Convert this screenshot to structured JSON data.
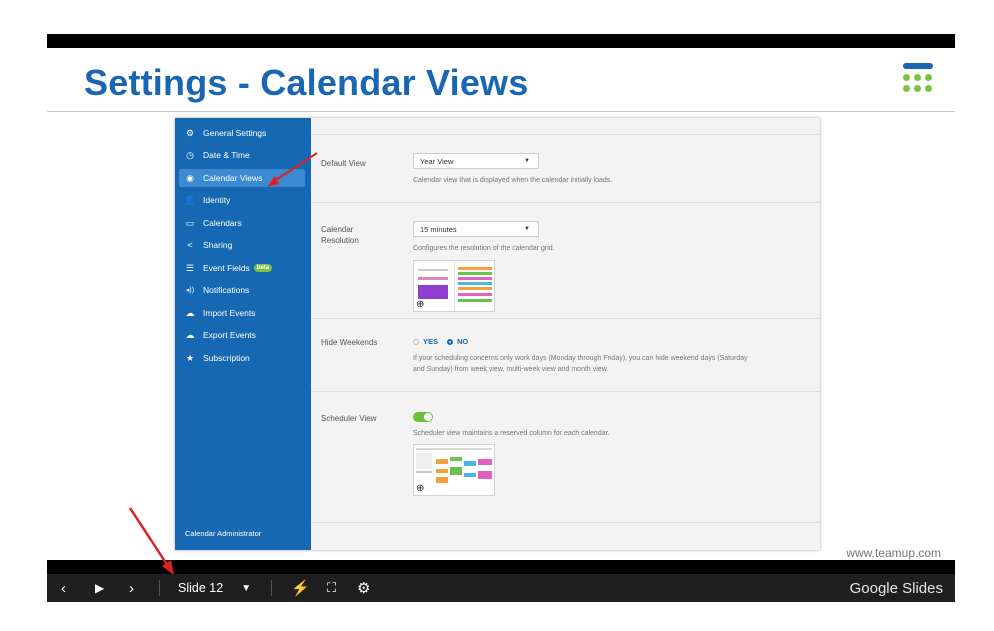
{
  "slide": {
    "title": "Settings - Calendar Views",
    "watermark": "www.teamup.com"
  },
  "sidebar": {
    "items": [
      {
        "label": "General Settings",
        "icon": "gear-icon",
        "glyph": "⚙"
      },
      {
        "label": "Date & Time",
        "icon": "clock-icon",
        "glyph": "◷"
      },
      {
        "label": "Calendar Views",
        "icon": "eye-icon",
        "glyph": "◉",
        "active": true
      },
      {
        "label": "Identity",
        "icon": "user-icon",
        "glyph": "👤"
      },
      {
        "label": "Calendars",
        "icon": "calendar-icon",
        "glyph": "▭"
      },
      {
        "label": "Sharing",
        "icon": "share-icon",
        "glyph": "<"
      },
      {
        "label": "Event Fields",
        "icon": "list-icon",
        "glyph": "☰",
        "badge": "beta"
      },
      {
        "label": "Notifications",
        "icon": "speaker-icon",
        "glyph": "◂))"
      },
      {
        "label": "Import Events",
        "icon": "cloud-upload-icon",
        "glyph": "☁"
      },
      {
        "label": "Export Events",
        "icon": "cloud-download-icon",
        "glyph": "☁"
      },
      {
        "label": "Subscription",
        "icon": "star-icon",
        "glyph": "★"
      }
    ],
    "footer": "Calendar Administrator"
  },
  "settings": {
    "default_view": {
      "label": "Default View",
      "value": "Year View",
      "description": "Calendar view that is displayed when the calendar initially loads."
    },
    "calendar_resolution": {
      "label_line1": "Calendar",
      "label_line2": "Resolution",
      "value": "15 minutes",
      "description": "Configures the resolution of the calendar grid."
    },
    "hide_weekends": {
      "label": "Hide Weekends",
      "yes": "YES",
      "no": "NO",
      "selected": "NO",
      "description_line1": "If your scheduling concerns only work days (Monday through Friday), you can hide weekend days (Saturday",
      "description_line2": "and Sunday) from week view, multi-week view and month view."
    },
    "scheduler_view": {
      "label": "Scheduler View",
      "enabled": true,
      "description": "Scheduler view maintains a reserved column for each calendar."
    }
  },
  "player": {
    "slide_label": "Slide 12",
    "brand": "Google Slides"
  },
  "colors": {
    "title_blue": "#1a66b2",
    "sidebar_blue": "#1668b2",
    "toggle_green": "#6ac13a",
    "badge_green": "#7cc142",
    "annotation_red": "#e02020"
  }
}
